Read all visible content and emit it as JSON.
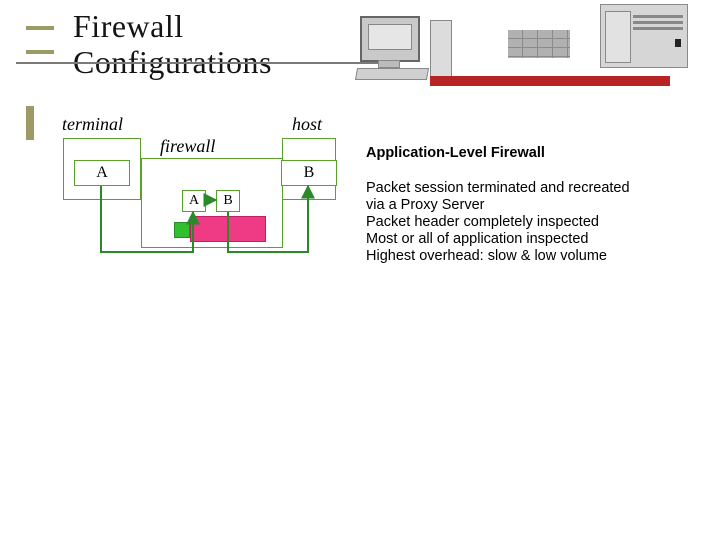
{
  "title_line1": "Firewall",
  "title_line2": "Configurations",
  "diagram": {
    "terminal_label": "terminal",
    "host_label": "host",
    "firewall_label": "firewall",
    "boxA": "A",
    "boxB": "B",
    "miniA": "A",
    "miniB": "B"
  },
  "section": {
    "heading": "Application-Level Firewall",
    "lines": [
      "Packet session terminated and recreated",
      "  via a Proxy Server",
      "Packet header completely inspected",
      "Most or all of application inspected",
      "Highest overhead: slow & low volume"
    ]
  }
}
